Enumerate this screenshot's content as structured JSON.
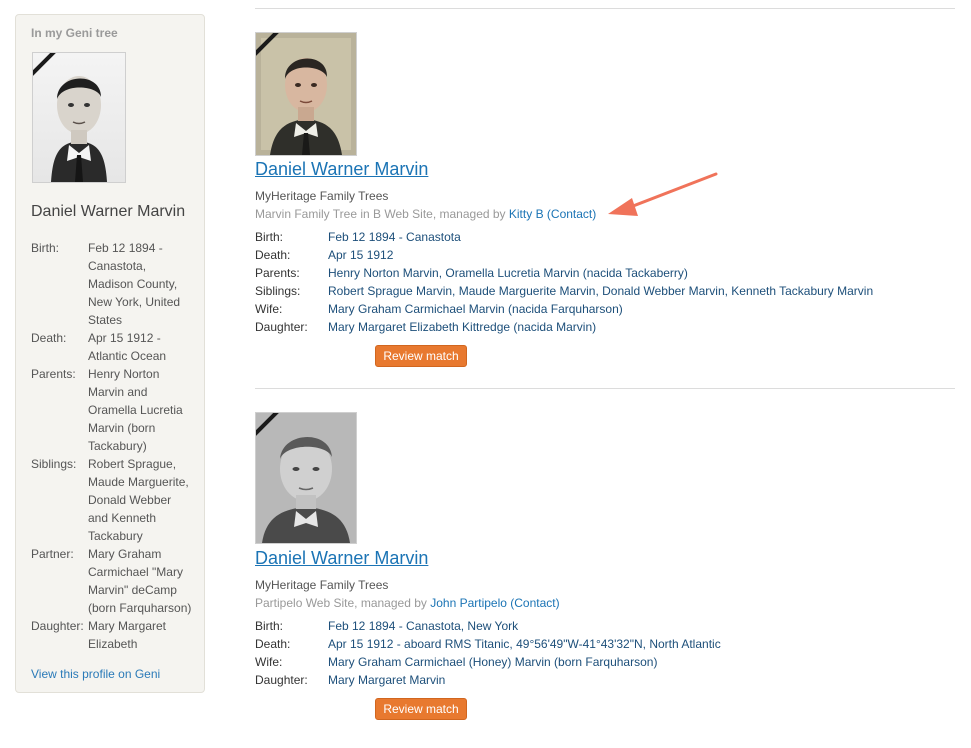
{
  "sidebar": {
    "title": "In my Geni tree",
    "name": "Daniel Warner Marvin",
    "facts": [
      {
        "k": "Birth:",
        "v": "Feb 12 1894 - Canastota, Madison County, New York, United States"
      },
      {
        "k": "Death:",
        "v": "Apr 15 1912 - Atlantic Ocean"
      },
      {
        "k": "Parents:",
        "v": "Henry Norton Marvin and Oramella Lucretia Marvin (born Tackabury)"
      },
      {
        "k": "Siblings:",
        "v": "Robert Sprague, Maude Marguerite, Donald Webber and Kenneth Tackabury"
      },
      {
        "k": "Partner:",
        "v": "Mary Graham Carmichael \"Mary Marvin\" deCamp (born Farquharson)"
      },
      {
        "k": "Daughter:",
        "v": "Mary Margaret Elizabeth"
      }
    ],
    "link": "View this profile on Geni"
  },
  "matches": [
    {
      "name": "Daniel Warner Marvin",
      "source": "MyHeritage Family Trees",
      "site_prefix": "Marvin Family Tree in B Web Site, managed by ",
      "manager": "Kitty B (Contact)",
      "facts": [
        {
          "k": "Birth:",
          "v": "Feb 12 1894 - Canastota"
        },
        {
          "k": "Death:",
          "v": "Apr 15 1912"
        },
        {
          "k": "Parents:",
          "v": "Henry Norton Marvin, Oramella Lucretia Marvin (nacida Tackaberry)"
        },
        {
          "k": "Siblings:",
          "v": "Robert Sprague Marvin, Maude Marguerite Marvin, Donald Webber Marvin, Kenneth Tackabury Marvin"
        },
        {
          "k": "Wife:",
          "v": "Mary Graham Carmichael Marvin (nacida Farquharson)"
        },
        {
          "k": "Daughter:",
          "v": "Mary Margaret Elizabeth Kittredge (nacida Marvin)"
        }
      ],
      "button": "Review match"
    },
    {
      "name": "Daniel Warner Marvin",
      "source": "MyHeritage Family Trees",
      "site_prefix": "Partipelo Web Site, managed by ",
      "manager": "John Partipelo (Contact)",
      "facts": [
        {
          "k": "Birth:",
          "v": "Feb 12 1894 - Canastota, New York"
        },
        {
          "k": "Death:",
          "v": "Apr 15 1912 - aboard RMS Titanic, 49°56'49\"W-41°43'32\"N, North Atlantic"
        },
        {
          "k": "Wife:",
          "v": "Mary Graham Carmichael (Honey) Marvin (born Farquharson)"
        },
        {
          "k": "Daughter:",
          "v": "Mary Margaret Marvin"
        }
      ],
      "button": "Review match"
    }
  ],
  "colors": {
    "link": "#1b74b5",
    "button": "#e8792f",
    "annotation_arrow": "#f0735a",
    "sidebar_bg": "#f5f4f0"
  },
  "icons": {
    "memorial_ribbon": "black-corner-ribbon-icon",
    "annotation": "red-arrow-annotation"
  }
}
